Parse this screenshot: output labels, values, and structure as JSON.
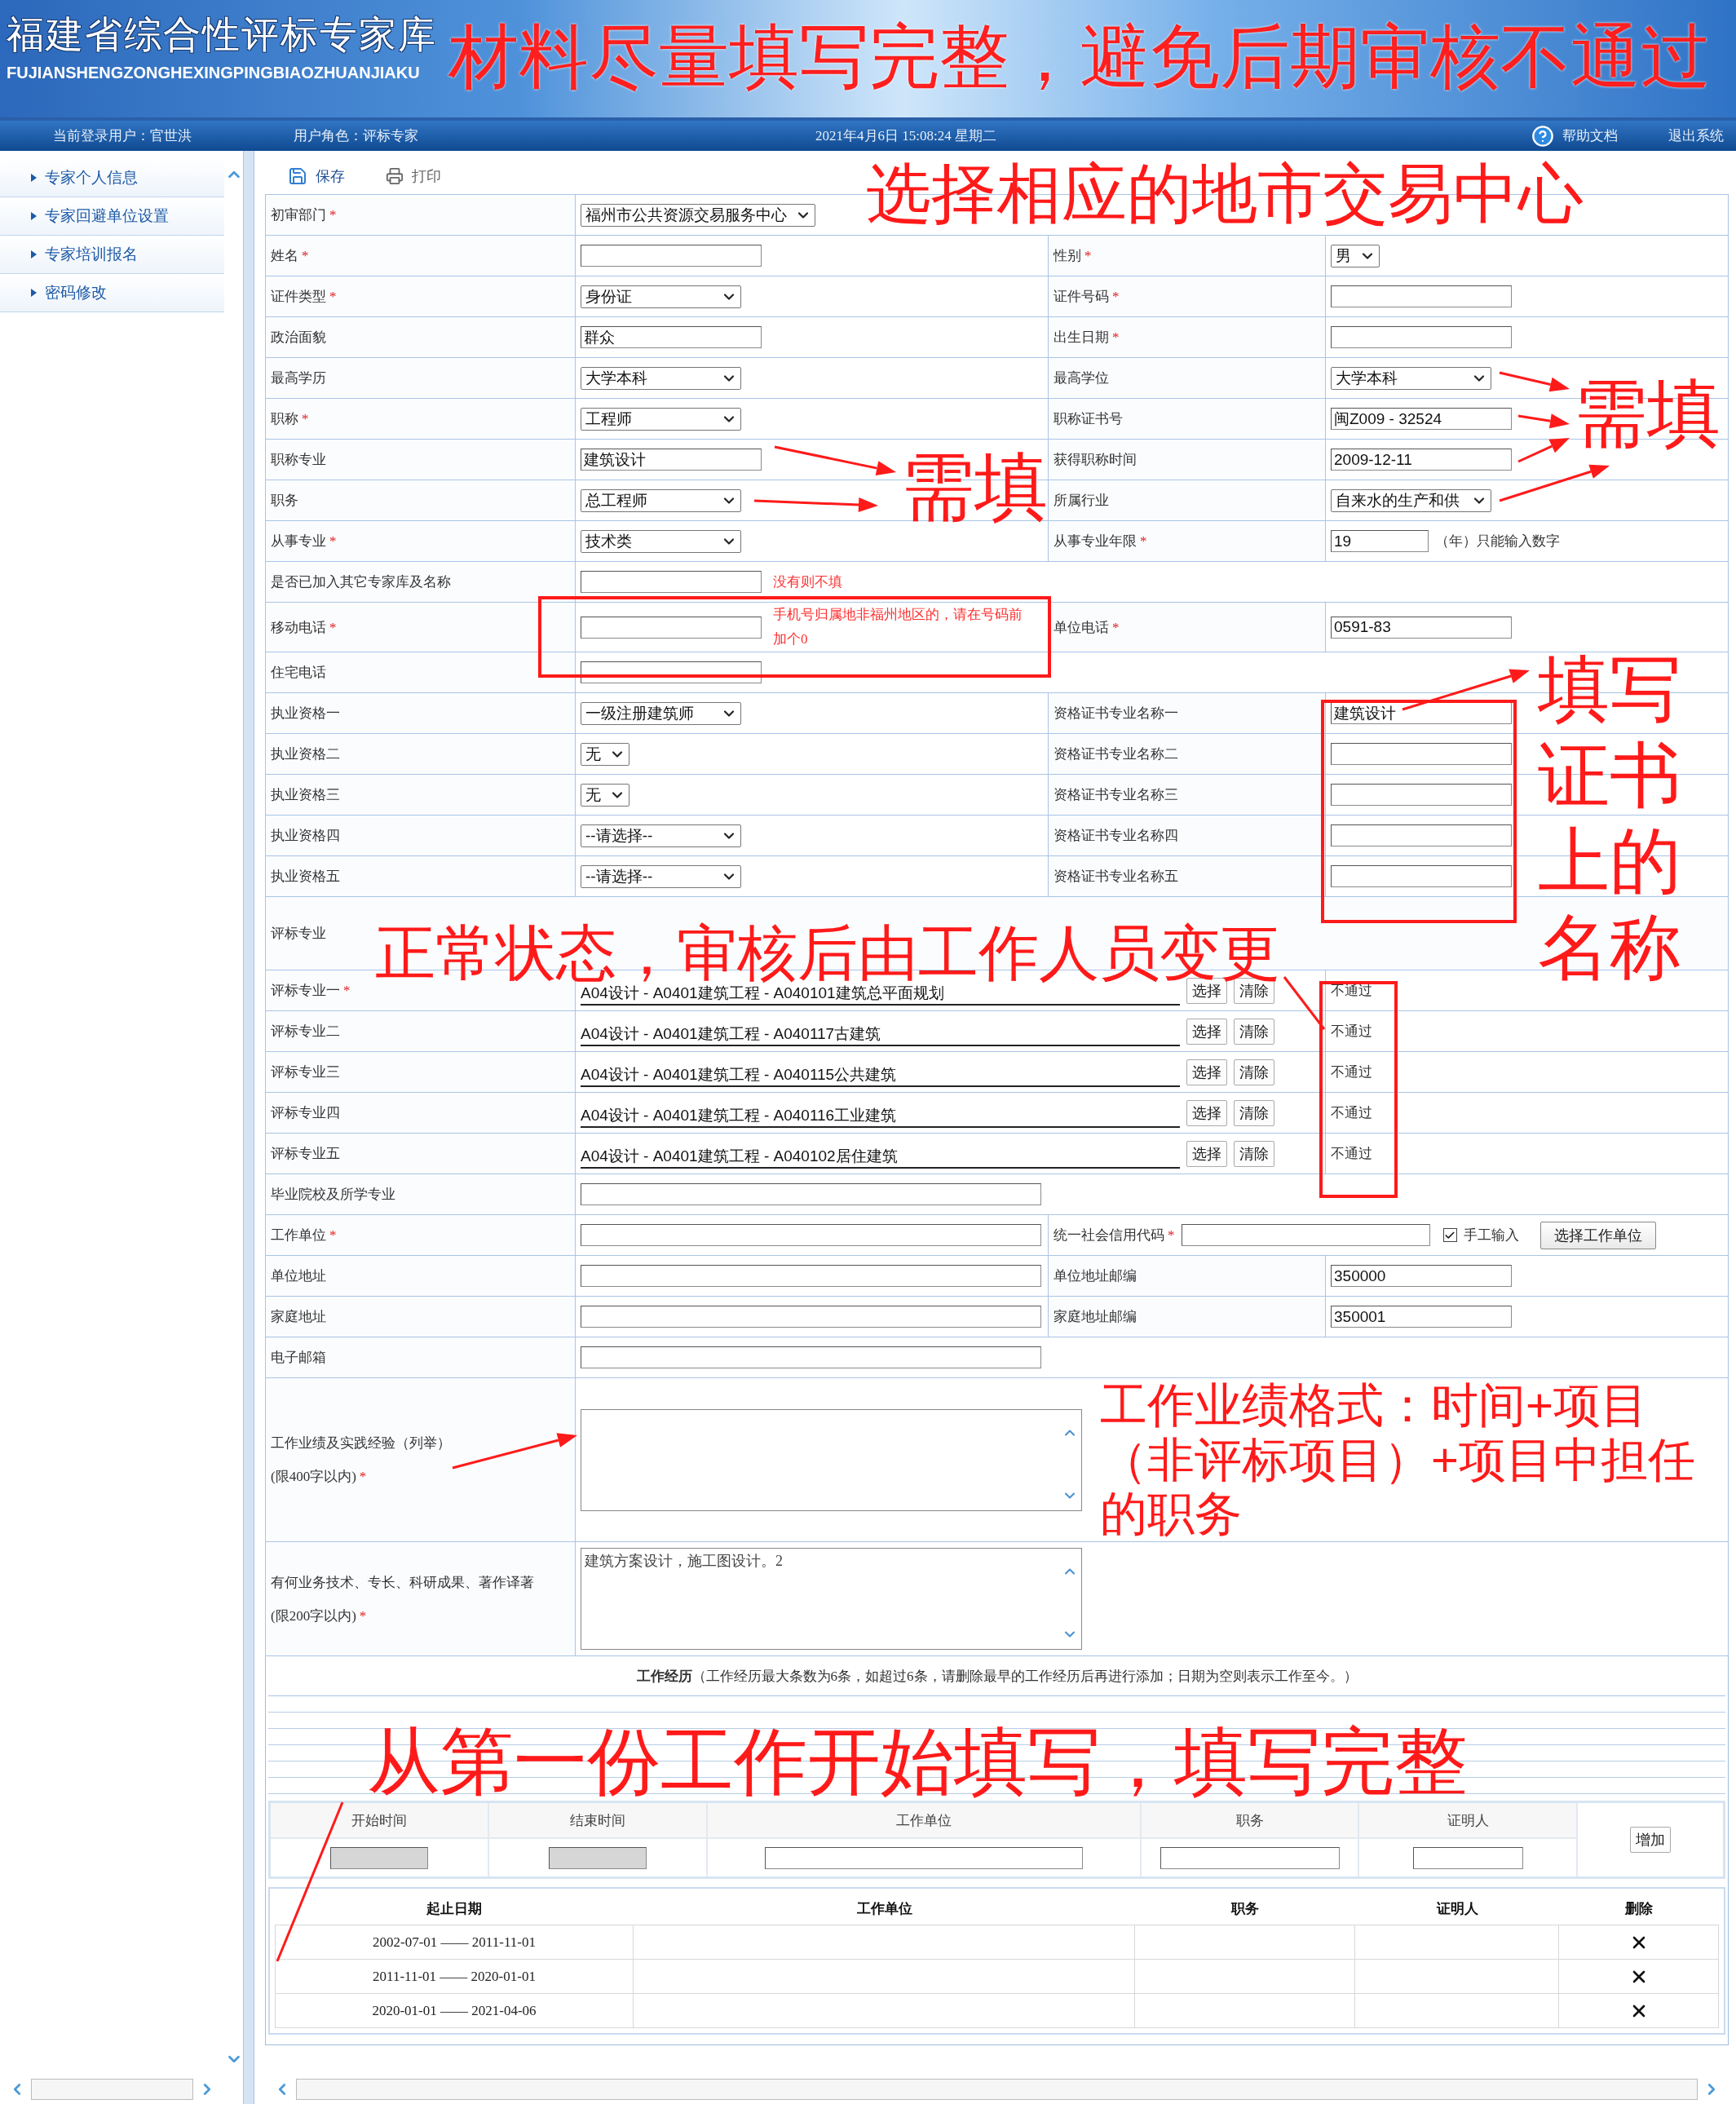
{
  "header": {
    "title": "福建省综合性评标专家库",
    "subtitle": "FUJIANSHENGZONGHEXINGPINGBIAOZHUANJIAKU",
    "notice": "材料尽量填写完整，避免后期审核不通过"
  },
  "info_bar": {
    "user": "当前登录用户：官世洪",
    "role": "用户角色：评标专家",
    "datetime": "2021年4月6日  15:08:24  星期二",
    "help": "帮助文档",
    "logout": "退出系统"
  },
  "sidebar": {
    "items": [
      "专家个人信息",
      "专家回避单位设置",
      "专家培训报名",
      "密码修改"
    ]
  },
  "toolbar": [
    {
      "kind": "save",
      "label": "保存"
    },
    {
      "kind": "print",
      "label": "打印"
    }
  ],
  "form": {
    "rows": [
      {
        "kind": "single",
        "items": [
          {
            "label": "初审部门",
            "star": "*",
            "field": {
              "kind": "select",
              "value": "福州市公共资源交易服务中心"
            }
          }
        ]
      },
      {
        "kind": "pair",
        "items": [
          {
            "label": "姓名",
            "star": "*",
            "field": {
              "kind": "input"
            }
          },
          {
            "label": "性别",
            "star": "*",
            "field": {
              "kind": "select",
              "value": "男"
            }
          }
        ]
      },
      {
        "kind": "pair",
        "items": [
          {
            "label": "证件类型",
            "star": "*",
            "field": {
              "kind": "select",
              "value": "身份证"
            }
          },
          {
            "label": "证件号码",
            "star": "*",
            "field": {
              "kind": "input"
            }
          }
        ]
      },
      {
        "kind": "pair",
        "items": [
          {
            "label": "政治面貌",
            "field": {
              "kind": "input",
              "value": "群众"
            }
          },
          {
            "label": "出生日期",
            "star": "*",
            "field": {
              "kind": "input"
            }
          }
        ]
      },
      {
        "kind": "pair",
        "items": [
          {
            "label": "最高学历",
            "field": {
              "kind": "select",
              "value": "大学本科"
            }
          },
          {
            "label": "最高学位",
            "field": {
              "kind": "select",
              "value": "大学本科"
            }
          }
        ]
      },
      {
        "kind": "pair",
        "items": [
          {
            "label": "职称",
            "star": "*",
            "field": {
              "kind": "select",
              "value": "工程师"
            }
          },
          {
            "label": "职称证书号",
            "field": {
              "kind": "input",
              "value": "闽Z009 - 32524"
            }
          }
        ]
      },
      {
        "kind": "pair",
        "items": [
          {
            "label": "职称专业",
            "field": {
              "kind": "input",
              "value": "建筑设计"
            }
          },
          {
            "label": "获得职称时间",
            "field": {
              "kind": "input",
              "value": "2009-12-11"
            }
          }
        ]
      },
      {
        "kind": "pair",
        "items": [
          {
            "label": "职务",
            "field": {
              "kind": "select",
              "value": "总工程师"
            }
          },
          {
            "label": "所属行业",
            "field": {
              "kind": "select",
              "value": "自来水的生产和供"
            }
          }
        ]
      },
      {
        "kind": "pair",
        "items": [
          {
            "label": "从事专业",
            "star": "*",
            "field": {
              "kind": "select",
              "value": "技术类"
            }
          },
          {
            "label": "从事专业年限",
            "star": "*",
            "field": {
              "kind": "input",
              "value": "19",
              "suffix": "（年）只能输入数字"
            }
          }
        ]
      },
      {
        "kind": "single",
        "items": [
          {
            "label": "是否已加入其它专家库及名称",
            "field": {
              "kind": "input",
              "note": "没有则不填"
            }
          }
        ]
      },
      {
        "kind": "pair",
        "items": [
          {
            "label": "移动电话",
            "star": "*",
            "field": {
              "kind": "input",
              "note": "手机号归属地非福州地区的，请在号码前加个0"
            }
          },
          {
            "label": "单位电话",
            "star": "*",
            "field": {
              "kind": "input",
              "value": "0591-83"
            }
          }
        ]
      },
      {
        "kind": "single",
        "items": [
          {
            "label": "住宅电话",
            "field": {
              "kind": "input"
            }
          }
        ]
      },
      {
        "kind": "pair",
        "items": [
          {
            "label": "执业资格一",
            "field": {
              "kind": "select",
              "value": "一级注册建筑师"
            }
          },
          {
            "label": "资格证书专业名称一",
            "field": {
              "kind": "input",
              "value": "建筑设计"
            }
          }
        ]
      },
      {
        "kind": "pair",
        "items": [
          {
            "label": "执业资格二",
            "field": {
              "kind": "select",
              "value": "无"
            }
          },
          {
            "label": "资格证书专业名称二",
            "field": {
              "kind": "input"
            }
          }
        ]
      },
      {
        "kind": "pair",
        "items": [
          {
            "label": "执业资格三",
            "field": {
              "kind": "select",
              "value": "无"
            }
          },
          {
            "label": "资格证书专业名称三",
            "field": {
              "kind": "input"
            }
          }
        ]
      },
      {
        "kind": "pair",
        "items": [
          {
            "label": "执业资格四",
            "field": {
              "kind": "select",
              "value": "--请选择--"
            }
          },
          {
            "label": "资格证书专业名称四",
            "field": {
              "kind": "input"
            }
          }
        ]
      },
      {
        "kind": "pair",
        "items": [
          {
            "label": "执业资格五",
            "field": {
              "kind": "select",
              "value": "--请选择--"
            }
          },
          {
            "label": "资格证书专业名称五",
            "field": {
              "kind": "input"
            }
          }
        ]
      },
      {
        "kind": "section",
        "label": "评标专业"
      },
      {
        "kind": "specialty",
        "label": "评标专业一",
        "star": "*",
        "value": "A04设计 - A0401建筑工程 - A040101建筑总平面规划",
        "buttons": [
          "选择",
          "清除"
        ],
        "status": "不通过"
      },
      {
        "kind": "specialty",
        "label": "评标专业二",
        "value": "A04设计 - A0401建筑工程 - A040117古建筑",
        "buttons": [
          "选择",
          "清除"
        ],
        "status": "不通过"
      },
      {
        "kind": "specialty",
        "label": "评标专业三",
        "value": "A04设计 - A0401建筑工程 - A040115公共建筑",
        "buttons": [
          "选择",
          "清除"
        ],
        "status": "不通过"
      },
      {
        "kind": "specialty",
        "label": "评标专业四",
        "value": "A04设计 - A0401建筑工程 - A040116工业建筑",
        "buttons": [
          "选择",
          "清除"
        ],
        "status": "不通过"
      },
      {
        "kind": "specialty",
        "label": "评标专业五",
        "value": "A04设计 - A0401建筑工程 - A040102居住建筑",
        "buttons": [
          "选择",
          "清除"
        ],
        "status": "不通过"
      },
      {
        "kind": "single",
        "items": [
          {
            "label": "毕业院校及所学专业",
            "field": {
              "kind": "input"
            }
          }
        ]
      },
      {
        "kind": "company",
        "label": "工作单位",
        "star": "*",
        "label2": "统一社会信用代码",
        "star2": "*",
        "checkbox": {
          "label": "手工输入",
          "checked": true
        },
        "button": "选择工作单位"
      },
      {
        "kind": "pair",
        "items": [
          {
            "label": "单位地址",
            "field": {
              "kind": "input"
            }
          },
          {
            "label": "单位地址邮编",
            "field": {
              "kind": "input",
              "value": "350000"
            }
          }
        ]
      },
      {
        "kind": "pair",
        "items": [
          {
            "label": "家庭地址",
            "field": {
              "kind": "input"
            }
          },
          {
            "label": "家庭地址邮编",
            "field": {
              "kind": "input",
              "value": "350001"
            }
          }
        ]
      },
      {
        "kind": "single",
        "items": [
          {
            "label": "电子邮箱",
            "field": {
              "kind": "input"
            }
          }
        ]
      },
      {
        "kind": "textarea",
        "label": "工作业绩及实践经验（列举）",
        "note": "(限400字以内)",
        "star": "*",
        "value": "",
        "annotation": "工作业绩格式：时间+项目（非评标项目）+项目中担任的职务"
      },
      {
        "kind": "textarea",
        "label": "有何业务技术、专长、科研成果、著作译著",
        "note": "(限200字以内)",
        "star": "*",
        "value": "建筑方案设计，施工图设计。2"
      }
    ]
  },
  "history": {
    "note": "**工作经历**（工作经历最大条数为6条，如超过6条，请删除最早的工作经历后再进行添加；日期为空则表示工作至今。）",
    "entry": {
      "columns": [
        {
          "label": "开始时间",
          "disabled": true
        },
        {
          "label": "结束时间",
          "disabled": true
        },
        {
          "label": "工作单位",
          "disabled": false
        },
        {
          "label": "职务",
          "disabled": false
        },
        {
          "label": "证明人",
          "disabled": false
        }
      ],
      "button": "增加"
    },
    "list": {
      "columns": [
        "起止日期",
        "工作单位",
        "职务",
        "证明人",
        "删除"
      ],
      "rows": [
        {
          "dates": "2002-07-01 —— 2011-11-01"
        },
        {
          "dates": "2011-11-01 —— 2020-01-01"
        },
        {
          "dates": "2020-01-01 —— 2021-04-06"
        }
      ]
    }
  },
  "annotations": [
    "选择相应的地市交易中心",
    "需填",
    "需填",
    "正常状态，审核后由工作人员变更",
    "填写证书上的名称",
    "从第一份工作开始填写，填写完整"
  ]
}
